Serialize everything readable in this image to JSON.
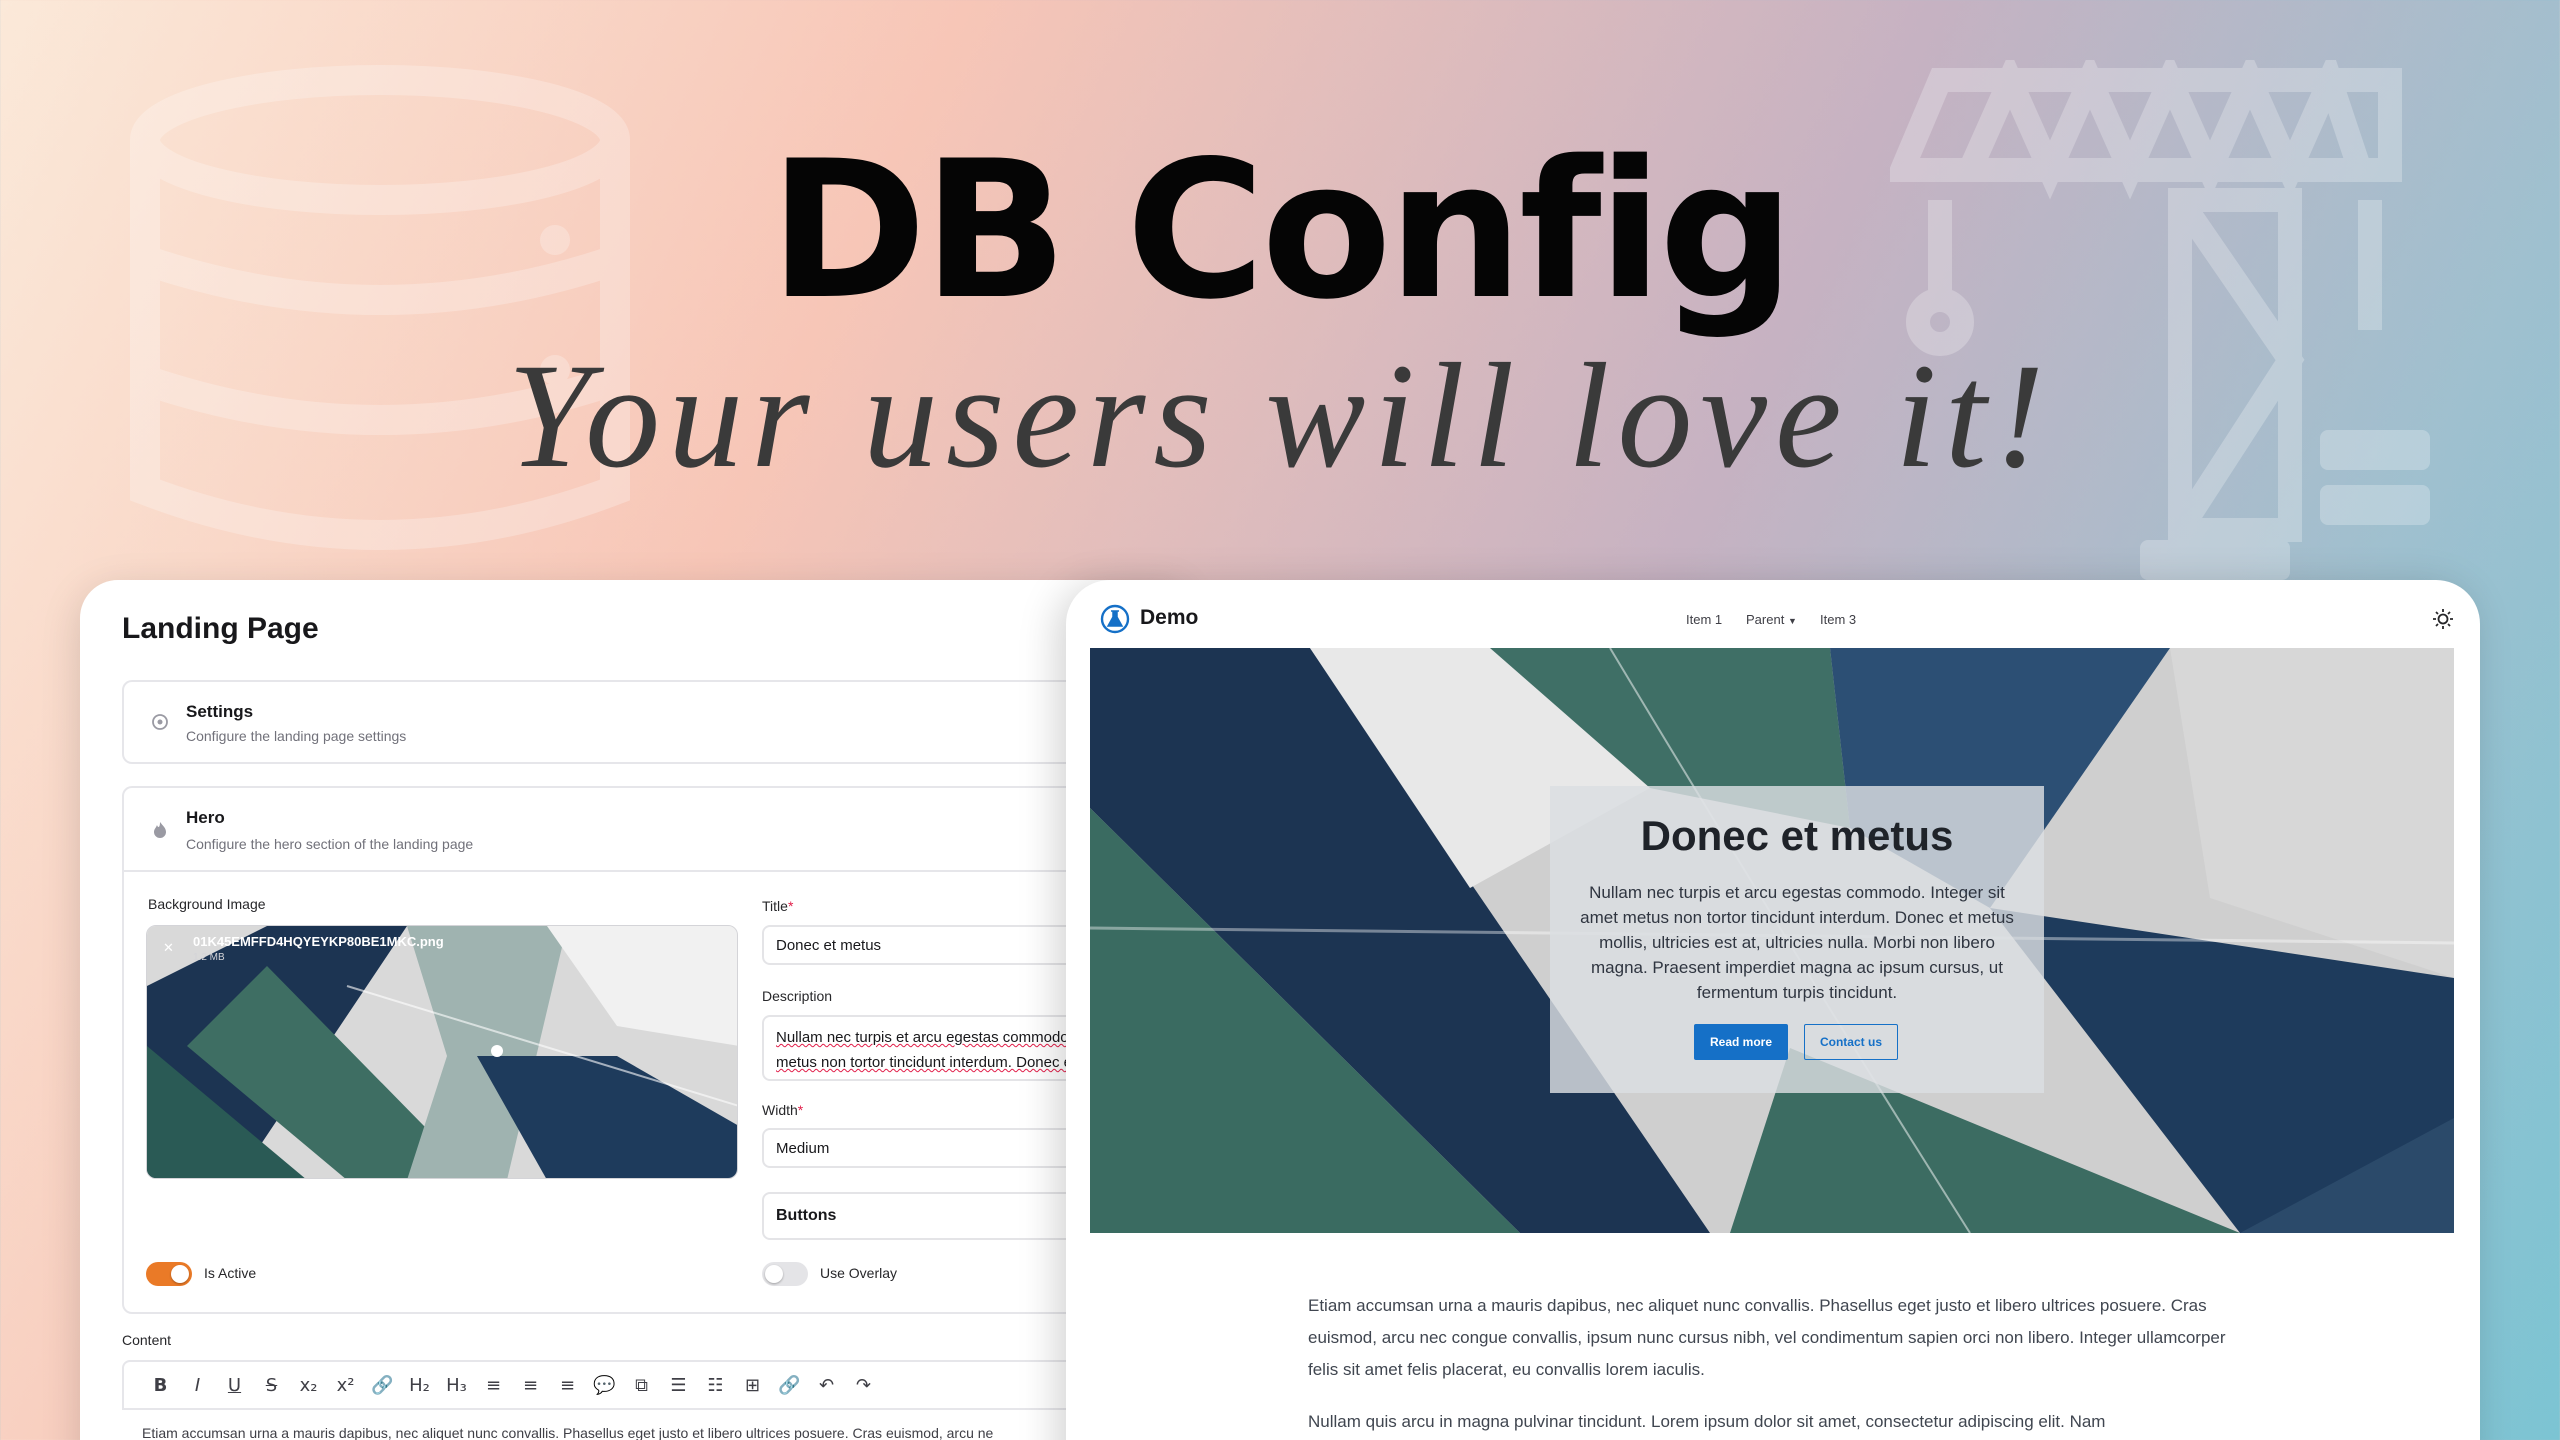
{
  "hero": {
    "title": "DB Config",
    "subtitle": "Your users will love it!"
  },
  "admin": {
    "page_title": "Landing Page",
    "settings": {
      "title": "Settings",
      "description": "Configure the landing page settings"
    },
    "hero_section": {
      "title": "Hero",
      "description": "Configure the hero section of the landing page"
    },
    "background_image_label": "Background Image",
    "file_name": "01K45EMFFD4HQYEYKP80BE1MKC.png",
    "file_size": "1.2 MB",
    "title_label": "Title",
    "title_value": "Donec et metus",
    "description_label": "Description",
    "description_value": "Nullam nec turpis et arcu egestas commodo. Integer sit amet metus non tortor tincidunt interdum. Donec et metus mollis,",
    "width_label": "Width",
    "width_value": "Medium",
    "buttons_label": "Buttons",
    "is_active_label": "Is Active",
    "is_active": true,
    "use_overlay_label": "Use Overlay",
    "use_overlay": false,
    "content_label": "Content",
    "toolbar": [
      "B",
      "I",
      "U",
      "S",
      "x₂",
      "x²",
      "🔗",
      "H₂",
      "H₃",
      "≡",
      "≡",
      "≡",
      "💬",
      "⧉",
      "☰",
      "☷",
      "⊞",
      "🔗",
      "↶",
      "↷"
    ],
    "content_preview": "Etiam accumsan urna a mauris dapibus, nec aliquet nunc convallis. Phasellus eget justo et libero ultrices posuere. Cras euismod, arcu ne"
  },
  "demo": {
    "brand": "Demo",
    "nav": [
      "Item 1",
      "Parent",
      "Item 3"
    ],
    "card_title": "Donec et metus",
    "card_text": "Nullam nec turpis et arcu egestas commodo. Integer sit amet metus non tortor tincidunt interdum. Donec et metus mollis, ultricies est at, ultricies nulla. Morbi non libero magna. Praesent imperdiet magna ac ipsum cursus, ut fermentum turpis tincidunt.",
    "primary_button": "Read more",
    "secondary_button": "Contact us",
    "paragraph1": "Etiam accumsan urna a mauris dapibus, nec aliquet nunc convallis. Phasellus eget justo et libero ultrices posuere. Cras euismod, arcu nec congue convallis, ipsum nunc cursus nibh, vel condimentum sapien orci non libero. Integer ullamcorper felis sit amet felis placerat, eu convallis lorem iaculis.",
    "paragraph2": "Nullam quis arcu in magna pulvinar tincidunt. Lorem ipsum dolor sit amet, consectetur adipiscing elit. Nam"
  },
  "colors": {
    "accent_orange": "#ea7a27",
    "primary_blue": "#1570c7"
  }
}
